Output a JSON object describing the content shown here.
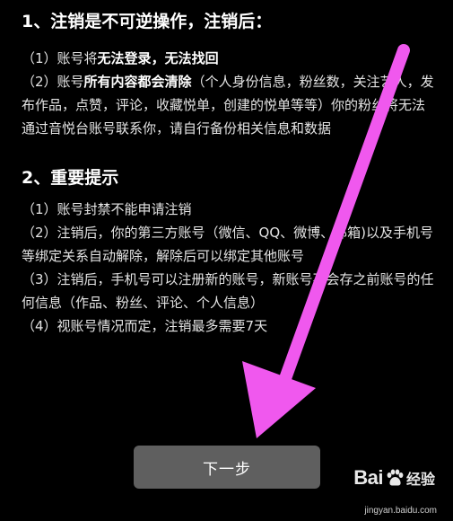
{
  "section1": {
    "title": "1、注销是不可逆操作，注销后：",
    "items": [
      {
        "prefix": "（1）账号将",
        "bold1": "无法登录",
        "mid": "，",
        "bold2": "无法找回",
        "suffix": ""
      },
      {
        "prefix": "（2）账号",
        "bold1": "所有内容都会清除",
        "suffix": "（个人身份信息，粉丝数，关注艺人，发布作品，点赞，评论，收藏悦单，创建的悦单等等）你的粉丝将无法通过音悦台账号联系你，请自行备份相关信息和数据"
      }
    ]
  },
  "section2": {
    "title": "2、重要提示",
    "items": [
      "（1）账号封禁不能申请注销",
      "（2）注销后，你的第三方账号（微信、QQ、微博、邮箱)以及手机号等绑定关系自动解除，解除后可以绑定其他账号",
      "（3）注销后，手机号可以注册新的账号，新账号不会存之前账号的任何信息（作品、粉丝、评论、个人信息）",
      "（4）视账号情况而定，注销最多需要7天"
    ]
  },
  "button": {
    "label": "下一步"
  },
  "watermark": {
    "brand": "Bai",
    "suffix": "经验",
    "url": "jingyan.baidu.com"
  },
  "colors": {
    "background": "#000000",
    "button": "#5f5f5f",
    "arrow": "#f058ee"
  },
  "icons": {
    "arrow": "annotation-arrow-icon",
    "paw": "baidu-paw-icon"
  }
}
